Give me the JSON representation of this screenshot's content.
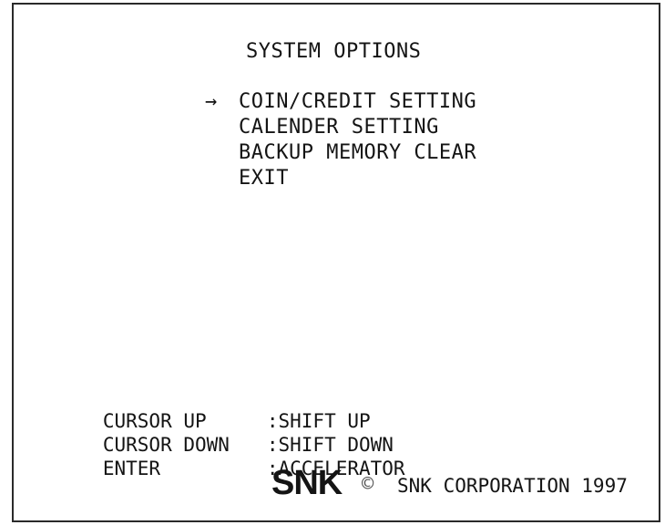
{
  "title": "SYSTEM OPTIONS",
  "cursor": "→",
  "menu": [
    {
      "label": "COIN/CREDIT SETTING",
      "selected": true
    },
    {
      "label": "CALENDER SETTING"
    },
    {
      "label": "BACKUP MEMORY CLEAR"
    },
    {
      "label": "EXIT"
    }
  ],
  "controls": [
    {
      "key": "CURSOR UP",
      "action": ":SHIFT UP"
    },
    {
      "key": "CURSOR DOWN",
      "action": ":SHIFT DOWN"
    },
    {
      "key": "ENTER",
      "action": ":ACCELERATOR"
    }
  ],
  "footer": {
    "logo": "SNK",
    "copyright_symbol": "©",
    "notice": "SNK CORPORATION 1997"
  }
}
